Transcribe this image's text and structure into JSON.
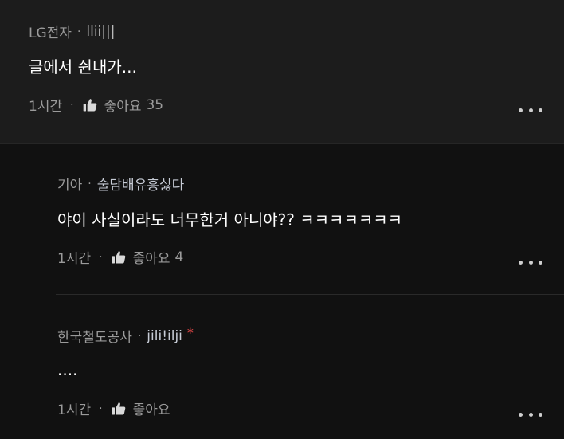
{
  "comments": [
    {
      "author": "LG전자",
      "nickname": "llii|||",
      "text": "글에서 쉰내가...",
      "time": "1시간",
      "like_label": "좋아요",
      "like_count": "35"
    },
    {
      "author": "기아",
      "nickname": "술담배유흥싫다",
      "text": "야이 사실이라도 너무한거 아니야?? ㅋㅋㅋㅋㅋㅋㅋ",
      "time": "1시간",
      "like_label": "좋아요",
      "like_count": "4"
    },
    {
      "author": "한국철도공사",
      "nickname": "jili!ilji",
      "badge": "*",
      "text": "....",
      "time": "1시간",
      "like_label": "좋아요",
      "like_count": ""
    }
  ],
  "separator": "·",
  "icons": {
    "like": "thumbs-up-icon",
    "more": "more-horizontal-icon"
  },
  "colors": {
    "background": "#111111",
    "top_comment_background": "#1c1c1c",
    "badge": "#e54848"
  }
}
